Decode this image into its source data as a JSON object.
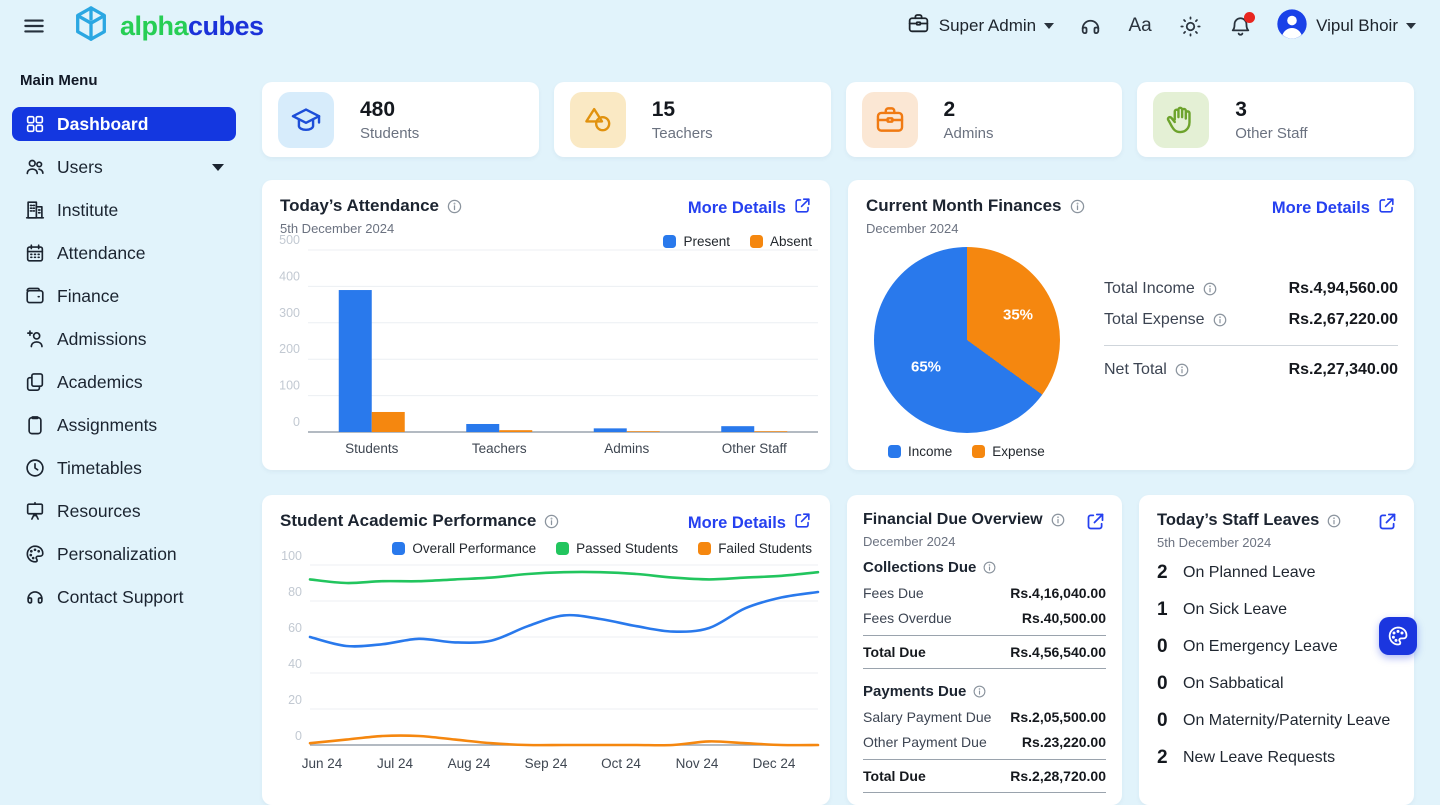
{
  "colors": {
    "accent_blue": "#1437E0",
    "link_blue": "#2540F0",
    "chart_blue": "#2979EC",
    "chart_orange": "#F5870F",
    "chart_green": "#22C55E",
    "brand_green": "#27CE55",
    "brand_blue": "#1B32D9",
    "notification_red": "#E8251F"
  },
  "header": {
    "brand": {
      "part1": "alpha",
      "part2": "cubes"
    },
    "role": "Super Admin",
    "font_size_label": "Aa",
    "user_name": "Vipul Bhoir"
  },
  "sidebar": {
    "section_label": "Main Menu",
    "items": [
      {
        "label": "Dashboard",
        "icon": "grid",
        "active": true
      },
      {
        "label": "Users",
        "icon": "users",
        "has_submenu": true
      },
      {
        "label": "Institute",
        "icon": "building"
      },
      {
        "label": "Attendance",
        "icon": "calendar"
      },
      {
        "label": "Finance",
        "icon": "wallet"
      },
      {
        "label": "Admissions",
        "icon": "person-add"
      },
      {
        "label": "Academics",
        "icon": "docs"
      },
      {
        "label": "Assignments",
        "icon": "clipboard"
      },
      {
        "label": "Timetables",
        "icon": "clock"
      },
      {
        "label": "Resources",
        "icon": "easel"
      },
      {
        "label": "Personalization",
        "icon": "palette"
      },
      {
        "label": "Contact Support",
        "icon": "headset"
      }
    ]
  },
  "stats": [
    {
      "value": "480",
      "label": "Students",
      "icon": "graduation-cap",
      "icon_color": "#1D4ED8",
      "icon_bg": "#D7ECFB"
    },
    {
      "value": "15",
      "label": "Teachers",
      "icon": "shapes",
      "icon_color": "#E1920E",
      "icon_bg": "#FAE9C4"
    },
    {
      "value": "2",
      "label": "Admins",
      "icon": "briefcase",
      "icon_color": "#F07A12",
      "icon_bg": "#FBE7D4"
    },
    {
      "value": "3",
      "label": "Other Staff",
      "icon": "hand",
      "icon_color": "#6DA32C",
      "icon_bg": "#E4F0D5"
    }
  ],
  "cards": {
    "attendance": {
      "title": "Today’s Attendance",
      "subtitle": "5th December 2024",
      "more_details": "More Details"
    },
    "finances": {
      "title": "Current Month Finances",
      "subtitle": "December 2024",
      "more_details": "More Details",
      "rows": [
        {
          "label": "Total Income",
          "value": "Rs.4,94,560.00"
        },
        {
          "label": "Total Expense",
          "value": "Rs.2,67,220.00"
        }
      ],
      "net_row": {
        "label": "Net Total",
        "value": "Rs.2,27,340.00"
      }
    },
    "performance": {
      "title": "Student Academic Performance",
      "more_details": "More Details"
    },
    "financial_due": {
      "title": "Financial Due Overview",
      "subtitle": "December 2024",
      "sections": [
        {
          "heading": "Collections Due",
          "rows": [
            {
              "label": "Fees Due",
              "value": "Rs.4,16,040.00"
            },
            {
              "label": "Fees Overdue",
              "value": "Rs.40,500.00"
            }
          ],
          "total": {
            "label": "Total Due",
            "value": "Rs.4,56,540.00"
          }
        },
        {
          "heading": "Payments Due",
          "rows": [
            {
              "label": "Salary Payment Due",
              "value": "Rs.2,05,500.00"
            },
            {
              "label": "Other Payment Due",
              "value": "Rs.23,220.00"
            }
          ],
          "total": {
            "label": "Total Due",
            "value": "Rs.2,28,720.00"
          }
        }
      ]
    },
    "staff_leaves": {
      "title": "Today’s Staff Leaves",
      "subtitle": "5th December 2024",
      "rows": [
        {
          "count": "2",
          "label": "On Planned Leave"
        },
        {
          "count": "1",
          "label": "On Sick Leave"
        },
        {
          "count": "0",
          "label": "On Emergency Leave"
        },
        {
          "count": "0",
          "label": "On Sabbatical"
        },
        {
          "count": "0",
          "label": "On Maternity/Paternity Leave"
        },
        {
          "count": "2",
          "label": "New Leave Requests"
        }
      ]
    }
  },
  "chart_data": [
    {
      "id": "attendance",
      "type": "bar",
      "title": "Today’s Attendance",
      "subtitle": "5th December 2024",
      "categories": [
        "Students",
        "Teachers",
        "Admins",
        "Other Staff"
      ],
      "series": [
        {
          "name": "Present",
          "color": "#2979EC",
          "values": [
            390,
            22,
            10,
            16
          ]
        },
        {
          "name": "Absent",
          "color": "#F5870F",
          "values": [
            55,
            5,
            2,
            2
          ]
        }
      ],
      "ylim": [
        0,
        500
      ],
      "yticks": [
        0,
        100,
        200,
        300,
        400,
        500
      ],
      "grid": true,
      "legend_position": "top-right"
    },
    {
      "id": "finances",
      "type": "pie",
      "title": "Current Month Finances",
      "subtitle": "December 2024",
      "slices": [
        {
          "name": "Income",
          "value": 65,
          "color": "#2979EC",
          "label": "65%"
        },
        {
          "name": "Expense",
          "value": 35,
          "color": "#F5870F",
          "label": "35%"
        }
      ],
      "start_angle_deg": 0,
      "direction": "clockwise (Expense slice first from 12 o'clock)",
      "legend_position": "bottom-left",
      "summary": {
        "total_income": "Rs.4,94,560.00",
        "total_expense": "Rs.2,67,220.00",
        "net_total": "Rs.2,27,340.00"
      }
    },
    {
      "id": "performance",
      "type": "line",
      "title": "Student Academic Performance",
      "x_labels": [
        "Jun 24",
        "Jul 24",
        "Aug 24",
        "Sep 24",
        "Oct 24",
        "Nov 24",
        "Dec 24"
      ],
      "sampling": "semi-monthly, 15 points Jun 24 through mid Dec 24",
      "series": [
        {
          "name": "Overall Performance",
          "color": "#2979EC",
          "values": [
            60,
            55,
            56,
            59,
            57,
            58,
            66,
            72,
            70,
            66,
            63,
            65,
            76,
            82,
            85
          ]
        },
        {
          "name": "Passed Students",
          "color": "#22C55E",
          "values": [
            92,
            90,
            91,
            91,
            92,
            93,
            95,
            96,
            96,
            95,
            93,
            92,
            93,
            94,
            96
          ]
        },
        {
          "name": "Failed Students",
          "color": "#F5870F",
          "values": [
            1,
            3,
            5,
            5,
            3,
            1,
            0,
            0,
            0,
            0,
            0,
            2,
            1,
            0,
            0
          ]
        }
      ],
      "ylim": [
        0,
        100
      ],
      "yticks": [
        0,
        20,
        40,
        60,
        80,
        100
      ],
      "grid": true,
      "legend_position": "top"
    }
  ]
}
